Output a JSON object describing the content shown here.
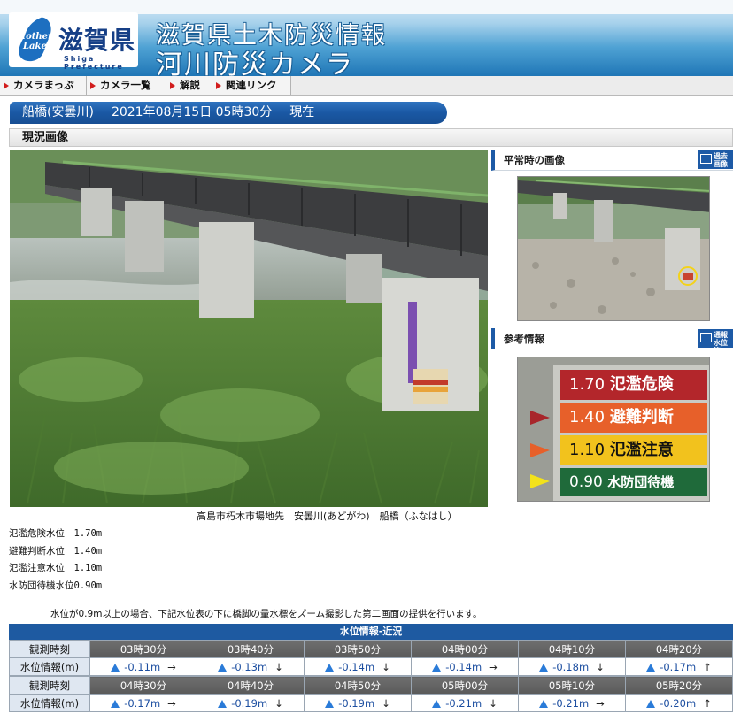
{
  "header": {
    "logo_mother": "Mother",
    "logo_lake": "Lake",
    "logo_name": "滋賀県",
    "logo_sub": "Shiga Prefecture",
    "title_line1": "滋賀県土木防災情報",
    "title_line2": "河川防災カメラ"
  },
  "nav": [
    {
      "label": "カメラまっぷ"
    },
    {
      "label": "カメラ一覧"
    },
    {
      "label": "解説"
    },
    {
      "label": "関連リンク"
    }
  ],
  "location_bar": {
    "station": "船橋(安曇川)",
    "datetime": "2021年08月15日 05時30分",
    "suffix": "現在"
  },
  "section_title": "現況画像",
  "normal_panel": {
    "title": "平常時の画像",
    "button": "過去画像"
  },
  "reference_panel": {
    "title": "参考情報",
    "button": "通報水位等",
    "signs": [
      {
        "value": "1.70",
        "label": "氾濫危険",
        "color": "#b3262b"
      },
      {
        "value": "1.40",
        "label": "避難判断",
        "color": "#e7602a"
      },
      {
        "value": "1.10",
        "label": "氾濫注意",
        "color": "#f2c21d"
      },
      {
        "value": "0.90",
        "label": "水防団待機",
        "color": "#1f6a3a"
      }
    ]
  },
  "caption": "高島市朽木市場地先　安曇川(あどがわ)　船橋（ふなはし）",
  "levels": [
    "氾濫危険水位　1.70m",
    "避難判断水位　1.40m",
    "氾濫注意水位　1.10m",
    "水防団待機水位0.90m"
  ],
  "note": "水位が0.9m以上の場合、下記水位表の下に橋脚の量水標をズーム撮影した第二画面の提供を行います。",
  "water_table": {
    "title": "水位情報-近況",
    "time_label": "観測時刻",
    "level_label": "水位情報(m)",
    "rows": [
      {
        "times": [
          "03時30分",
          "03時40分",
          "03時50分",
          "04時00分",
          "04時10分",
          "04時20分"
        ],
        "values": [
          "-0.11m",
          "-0.13m",
          "-0.14m",
          "-0.14m",
          "-0.18m",
          "-0.17m"
        ],
        "trends": [
          "→",
          "↓",
          "↓",
          "→",
          "↓",
          "↑"
        ]
      },
      {
        "times": [
          "04時30分",
          "04時40分",
          "04時50分",
          "05時00分",
          "05時10分",
          "05時20分"
        ],
        "values": [
          "-0.17m",
          "-0.19m",
          "-0.19m",
          "-0.21m",
          "-0.21m",
          "-0.20m"
        ],
        "trends": [
          "→",
          "↓",
          "↓",
          "↓",
          "→",
          "↑"
        ]
      }
    ]
  }
}
